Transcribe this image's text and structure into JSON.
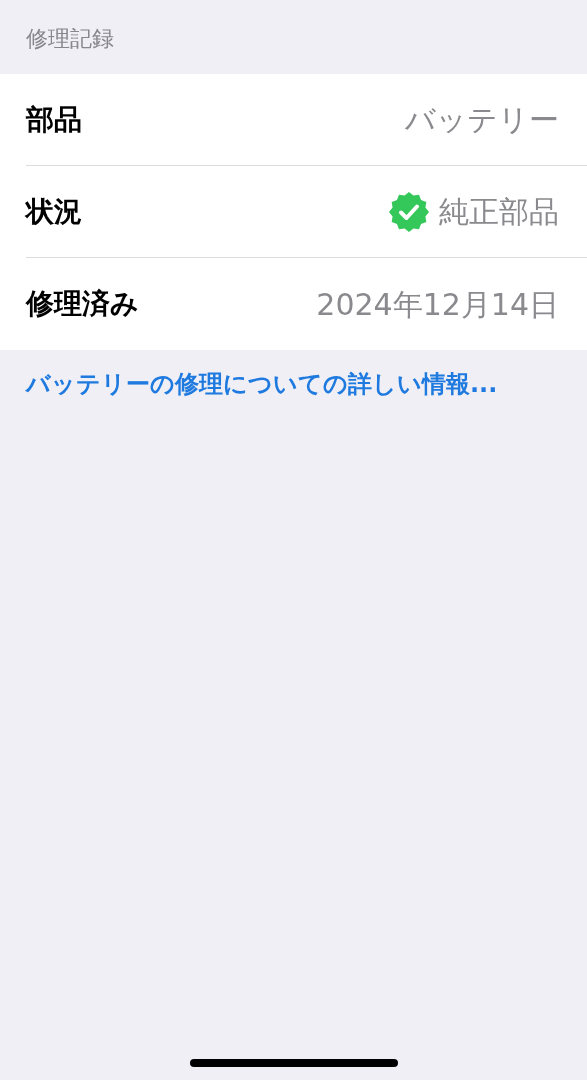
{
  "section_header": "修理記録",
  "rows": [
    {
      "kind": "plain",
      "label": "部品",
      "value": "バッテリー"
    },
    {
      "kind": "verified",
      "label": "状況",
      "value": "純正部品"
    },
    {
      "kind": "plain",
      "label": "修理済み",
      "value": "2024年12月14日"
    }
  ],
  "link": "バッテリーの修理についての詳しい情報..."
}
